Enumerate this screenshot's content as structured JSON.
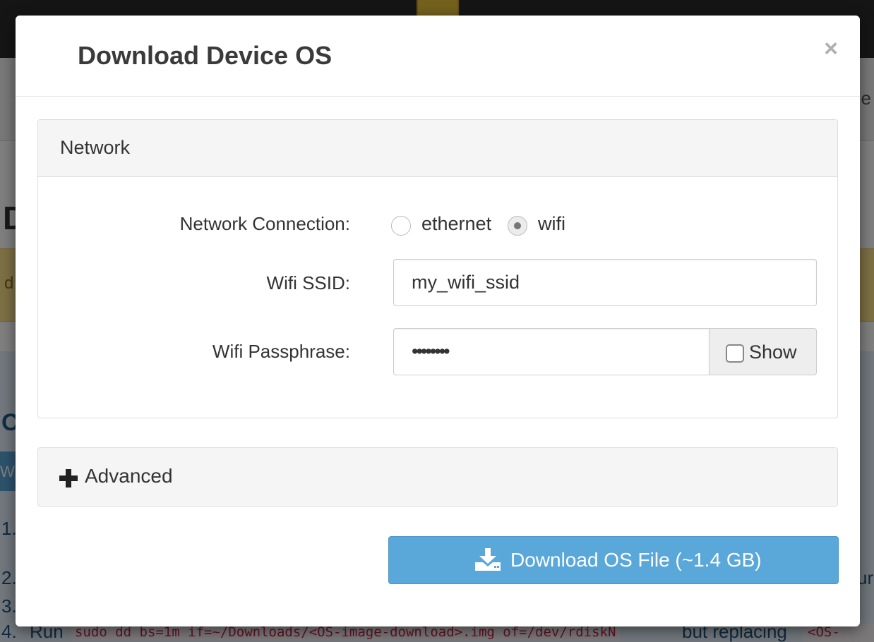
{
  "background": {
    "nav_fragment": "e",
    "heading_fragment": "D",
    "alert_fragment": "d",
    "info_fragment": "O",
    "tab_fragment": "Wi",
    "step1": "1.",
    "step2": "2.",
    "step3": "3.",
    "step4": "4.",
    "step4_run": "Run",
    "step4_command": "sudo dd bs=1m if=~/Downloads/<OS-image-download>.img of=/dev/rdiskN",
    "step4_middle": "but replacing",
    "step4_code2": "<OS-imag",
    "step2_tail": "ur"
  },
  "modal": {
    "title": "Download Device OS",
    "close_symbol": "×",
    "network_panel": {
      "title": "Network",
      "connection_label": "Network Connection:",
      "options": [
        {
          "label": "ethernet",
          "checked": false
        },
        {
          "label": "wifi",
          "checked": true
        }
      ],
      "ssid_label": "Wifi SSID:",
      "ssid_value": "my_wifi_ssid",
      "passphrase_label": "Wifi Passphrase:",
      "passphrase_value": "••••••••",
      "show_label": "Show",
      "show_checked": false
    },
    "advanced_label": "Advanced",
    "download_label": "Download OS File (~1.4 GB)"
  },
  "colors": {
    "primary": "#5aa7d9",
    "overlay": "rgba(0,0,0,0.5)"
  },
  "icons": [
    "close-icon",
    "plus-icon",
    "download-icon"
  ]
}
